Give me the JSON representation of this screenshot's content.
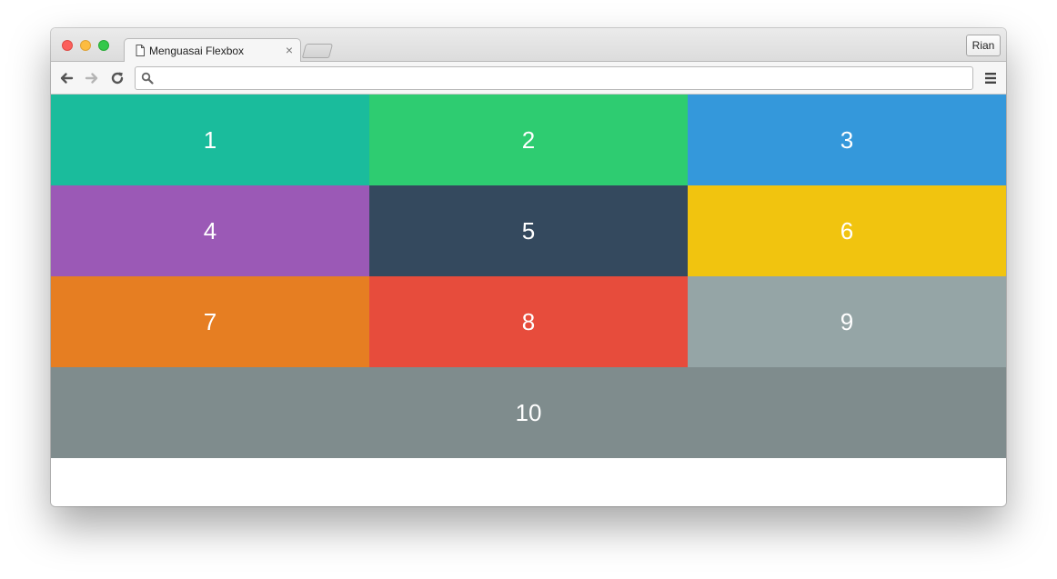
{
  "browser": {
    "tab_title": "Menguasai Flexbox",
    "tab_close": "×",
    "profile_name": "Rian",
    "address_value": ""
  },
  "icons": {
    "back": "back-arrow-icon",
    "forward": "forward-arrow-icon",
    "reload": "reload-icon",
    "search": "search-icon",
    "menu": "hamburger-menu-icon",
    "page": "page-icon"
  },
  "boxes": [
    {
      "label": "1",
      "color": "#1abc9c"
    },
    {
      "label": "2",
      "color": "#2ecc71"
    },
    {
      "label": "3",
      "color": "#3498db"
    },
    {
      "label": "4",
      "color": "#9b59b6"
    },
    {
      "label": "5",
      "color": "#34495e"
    },
    {
      "label": "6",
      "color": "#f1c40f"
    },
    {
      "label": "7",
      "color": "#e67e22"
    },
    {
      "label": "8",
      "color": "#e74c3c"
    },
    {
      "label": "9",
      "color": "#95a5a6"
    },
    {
      "label": "10",
      "color": "#7f8c8d"
    }
  ]
}
